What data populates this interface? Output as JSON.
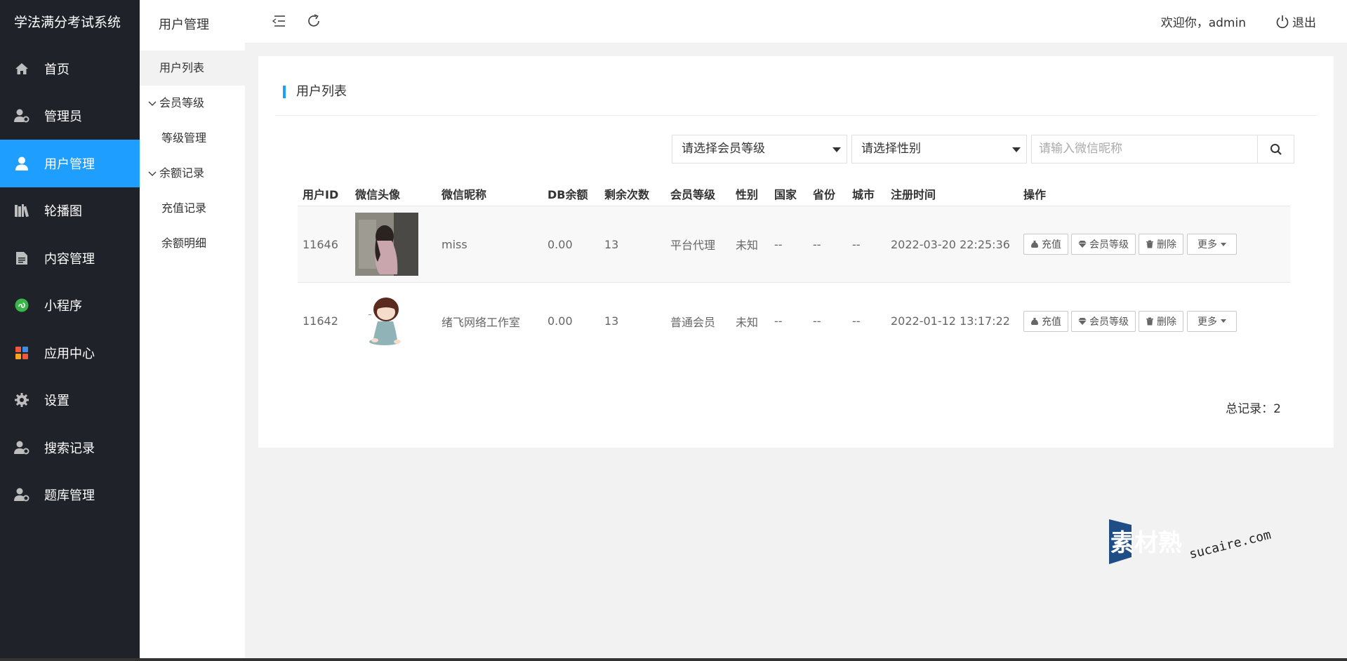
{
  "app": {
    "title": "学法满分考试系统"
  },
  "sidebar": {
    "items": [
      {
        "label": "首页",
        "icon": "home-icon",
        "active": false
      },
      {
        "label": "管理员",
        "icon": "admin-user-icon",
        "active": false
      },
      {
        "label": "用户管理",
        "icon": "user-icon",
        "active": true
      },
      {
        "label": "轮播图",
        "icon": "books-icon",
        "active": false
      },
      {
        "label": "内容管理",
        "icon": "document-icon",
        "active": false
      },
      {
        "label": "小程序",
        "icon": "miniprogram-icon",
        "active": false
      },
      {
        "label": "应用中心",
        "icon": "apps-grid-icon",
        "active": false
      },
      {
        "label": "设置",
        "icon": "gear-icon",
        "active": false
      },
      {
        "label": "搜索记录",
        "icon": "search-record-icon",
        "active": false
      },
      {
        "label": "题库管理",
        "icon": "question-bank-icon",
        "active": false
      }
    ]
  },
  "subnav": {
    "title": "用户管理",
    "items": {
      "user_list": "用户列表",
      "member_level": "会员等级",
      "level_manage": "等级管理",
      "balance_records": "余额记录",
      "recharge_records": "充值记录",
      "balance_detail": "余额明细"
    }
  },
  "header": {
    "welcome": "欢迎你，admin",
    "logout": "退出"
  },
  "card": {
    "title": "用户列表",
    "filters": {
      "level_placeholder": "请选择会员等级",
      "gender_placeholder": "请选择性别",
      "nickname_placeholder": "请输入微信昵称"
    },
    "columns": [
      "用户ID",
      "微信头像",
      "微信昵称",
      "DB余额",
      "剩余次数",
      "会员等级",
      "性别",
      "国家",
      "省份",
      "城市",
      "注册时间",
      "操作"
    ],
    "rows": [
      {
        "id": "11646",
        "nickname": "miss",
        "balance": "0.00",
        "remaining": "13",
        "level": "平台代理",
        "gender": "未知",
        "country": "--",
        "province": "--",
        "city": "--",
        "registered": "2022-03-20 22:25:36"
      },
      {
        "id": "11642",
        "nickname": "绪飞网络工作室",
        "balance": "0.00",
        "remaining": "13",
        "level": "普通会员",
        "gender": "未知",
        "country": "--",
        "province": "--",
        "city": "--",
        "registered": "2022-01-12 13:17:22"
      }
    ],
    "actions": {
      "recharge": "充值",
      "member_level": "会员等级",
      "delete": "删除",
      "more": "更多"
    },
    "total": "总记录：2"
  },
  "watermark": {
    "brand": "素材熟",
    "domain": "sucaire.com"
  },
  "colors": {
    "sidebar_bg": "#20222a",
    "accent": "#1e9fff",
    "page_bg": "#f2f2f2"
  }
}
